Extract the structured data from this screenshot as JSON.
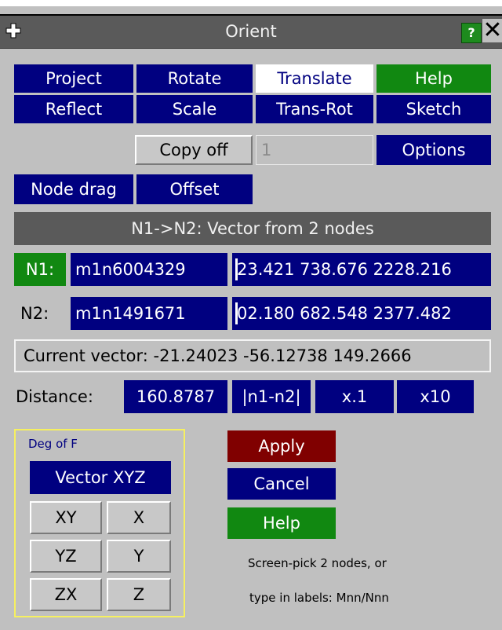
{
  "window": {
    "title": "Orient"
  },
  "icons": {
    "move": "move-cross-icon",
    "help": "help-icon",
    "close": "close-icon"
  },
  "title_help": "?",
  "title_close": "✕",
  "mode_buttons": {
    "project": "Project",
    "rotate": "Rotate",
    "translate": "Translate",
    "help": "Help",
    "reflect": "Reflect",
    "scale": "Scale",
    "trans_rot": "Trans-Rot",
    "sketch": "Sketch"
  },
  "copy": {
    "label": "Copy off",
    "value": "1",
    "options": "Options"
  },
  "drag": {
    "node_drag": "Node drag",
    "offset": "Offset"
  },
  "method_header": "N1->N2: Vector from 2 nodes",
  "n1": {
    "label": "N1:",
    "node": "m1n6004329",
    "coords": "23.421 738.676 2228.216"
  },
  "n2": {
    "label": "N2:",
    "node": "m1n1491671",
    "coords": "02.180 682.548 2377.482"
  },
  "current_vector": "Current vector: -21.24023  -56.12738  149.2666",
  "distance": {
    "label": "Distance:",
    "value": "160.8787",
    "abs": "|n1-n2|",
    "x01": "x.1",
    "x10": "x10"
  },
  "dof": {
    "title": "Deg of F",
    "vector": "Vector XYZ",
    "xy": "XY",
    "x": "X",
    "yz": "YZ",
    "y": "Y",
    "zx": "ZX",
    "z": "Z"
  },
  "actions": {
    "apply": "Apply",
    "cancel": "Cancel",
    "help": "Help"
  },
  "hints": {
    "line1": "Screen-pick 2 nodes, or",
    "line2": "type in labels: Mnn/Nnn"
  },
  "colors": {
    "navy": "#000080",
    "green": "#118811",
    "red": "#800000",
    "panel": "#c0c0c0",
    "titlebar": "#5a5a5a"
  }
}
